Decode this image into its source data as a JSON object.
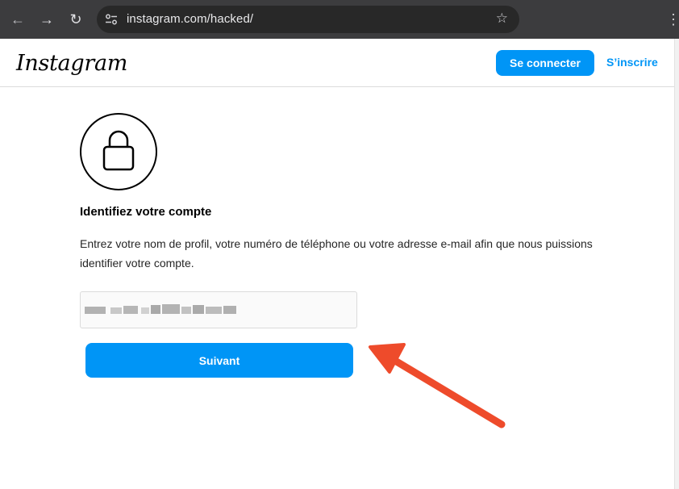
{
  "browser": {
    "url": "instagram.com/hacked/"
  },
  "header": {
    "logo": "Instagram",
    "login_label": "Se connecter",
    "signup_label": "S’inscrire"
  },
  "main": {
    "title": "Identifiez votre compte",
    "description": "Entrez votre nom de profil, votre numéro de téléphone ou votre adresse e-mail afin que nous puissions identifier votre compte.",
    "input_value_redacted": true,
    "next_label": "Suivant"
  },
  "colors": {
    "accent": "#0095f6",
    "annotation_arrow": "#ee4b2b",
    "chrome": "#3c3c3e"
  },
  "icons": [
    "back-arrow-icon",
    "forward-arrow-icon",
    "reload-icon",
    "site-settings-icon",
    "bookmark-star-icon",
    "menu-kebab-icon",
    "lock-icon"
  ]
}
